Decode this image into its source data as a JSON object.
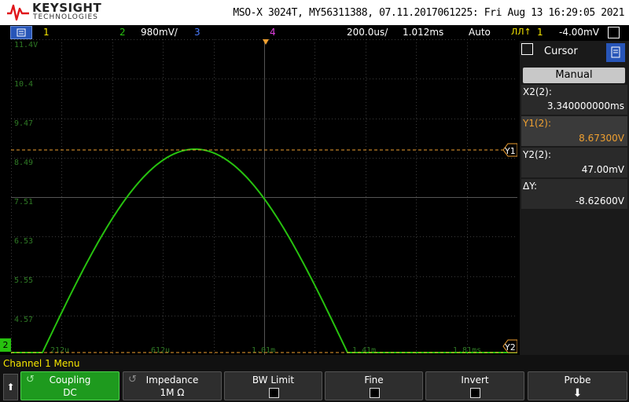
{
  "header": {
    "brand": "KEYSIGHT",
    "brand_sub": "TECHNOLOGIES",
    "info": "MSO-X 3024T, MY56311388, 07.11.2017061225: Fri Aug 13 16:29:05 2021"
  },
  "status_bar": {
    "ch1": "1",
    "ch2": "2",
    "ch2_scale": "980mV/",
    "ch3": "3",
    "ch4": "4",
    "timebase": "200.0us/",
    "delay": "1.012ms",
    "trigger_mode": "Auto",
    "trigger_source": "1",
    "trigger_level": "-4.00mV"
  },
  "grid": {
    "y_labels": [
      "11.4V",
      "10.4",
      "9.47",
      "8.49",
      "7.51",
      "6.53",
      "5.55",
      "4.57"
    ],
    "x_labels": [
      "212u",
      "612u",
      "1.01m",
      "1.41m",
      "1.81ms"
    ],
    "y1_marker": "Y1",
    "y2_marker": "Y2",
    "ground_marker": "2",
    "colors": {
      "trace": "#27c20f",
      "cursor": "#f0a030",
      "grid": "#3a3a3a"
    }
  },
  "cursor_panel": {
    "title": "Cursor",
    "mode": "Manual",
    "x2_label": "X2(2):",
    "x2_value": "3.340000000ms",
    "y1_label": "Y1(2):",
    "y1_value": "8.67300V",
    "y2_label": "Y2(2):",
    "y2_value": "47.00mV",
    "dy_label": "ΔY:",
    "dy_value": "-8.62600V"
  },
  "menu": {
    "title": "Channel 1 Menu",
    "softkeys": [
      {
        "label": "Coupling",
        "value": "DC"
      },
      {
        "label": "Impedance",
        "value": "1M Ω"
      },
      {
        "label": "BW Limit",
        "value": ""
      },
      {
        "label": "Fine",
        "value": ""
      },
      {
        "label": "Invert",
        "value": ""
      },
      {
        "label": "Probe",
        "value": ""
      }
    ]
  }
}
